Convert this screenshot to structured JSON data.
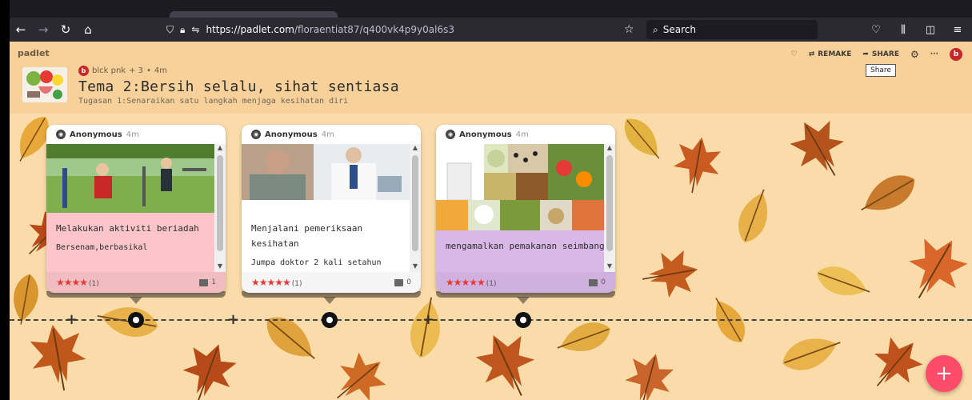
{
  "browser": {
    "url_host": "https://padlet.com",
    "url_path": "/floraentiat87/q400vk4p9y0al6s3",
    "search_placeholder": "Search"
  },
  "padlet": {
    "brand": "padlet",
    "author": "blck pnk",
    "author_initial": "b",
    "contributors": "+ 3",
    "dot": "•",
    "age": "4m",
    "title": "Tema 2:Bersih selalu, sihat sentiasa",
    "description": "Tugasan 1:Senaraikan satu langkah menjaga kesihatan diri",
    "actions": {
      "remake": "REMAKE",
      "share": "SHARE",
      "more": "···",
      "avatar_initial": "b"
    },
    "tooltip": "Share"
  },
  "posts": [
    {
      "author": "Anonymous",
      "time": "4m",
      "subject": "Melakukan aktiviti beriadah",
      "body": "Bersenam,berbasikal",
      "stars": "★★★★",
      "rating_count": "(1)",
      "comments": "1",
      "color": "#fbc5c9"
    },
    {
      "author": "Anonymous",
      "time": "4m",
      "subject": "Menjalani pemeriksaan kesihatan",
      "body": "Jumpa doktor 2 kali setahun",
      "stars": "★★★★★",
      "rating_count": "(1)",
      "comments": "0",
      "color": "#ffffff"
    },
    {
      "author": "Anonymous",
      "time": "4m",
      "subject": "mengamalkan pemakanan seimbang",
      "body": "",
      "stars": "★★★★★",
      "rating_count": "(1)",
      "comments": "0",
      "color": "#d9b8e8"
    }
  ],
  "fab_label": "+"
}
